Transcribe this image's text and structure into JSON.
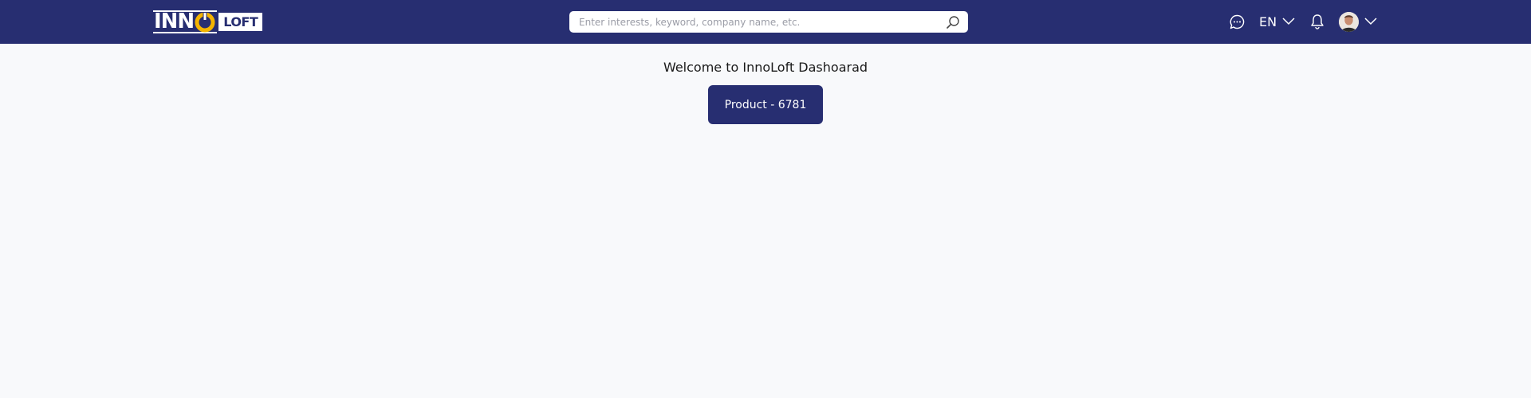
{
  "header": {
    "logo": {
      "part1": "INN",
      "part2": "LOFT",
      "icon": "power-o-icon",
      "accent_color": "#f4b400"
    },
    "search": {
      "placeholder": "Enter interests, keyword, company name, etc.",
      "value": "",
      "icon": "search-icon"
    },
    "icons": {
      "messages": "chat-icon",
      "notifications": "bell-icon",
      "chevron": "chevron-down-icon"
    },
    "language": "EN",
    "user": {
      "avatar": "avatar"
    }
  },
  "main": {
    "welcome_text": "Welcome to InnoLoft Dashoarad",
    "product_button_label": "Product - 6781"
  },
  "colors": {
    "primary": "#272e71",
    "background": "#f8f9fb",
    "white": "#ffffff",
    "logo_accent": "#f4b400"
  }
}
